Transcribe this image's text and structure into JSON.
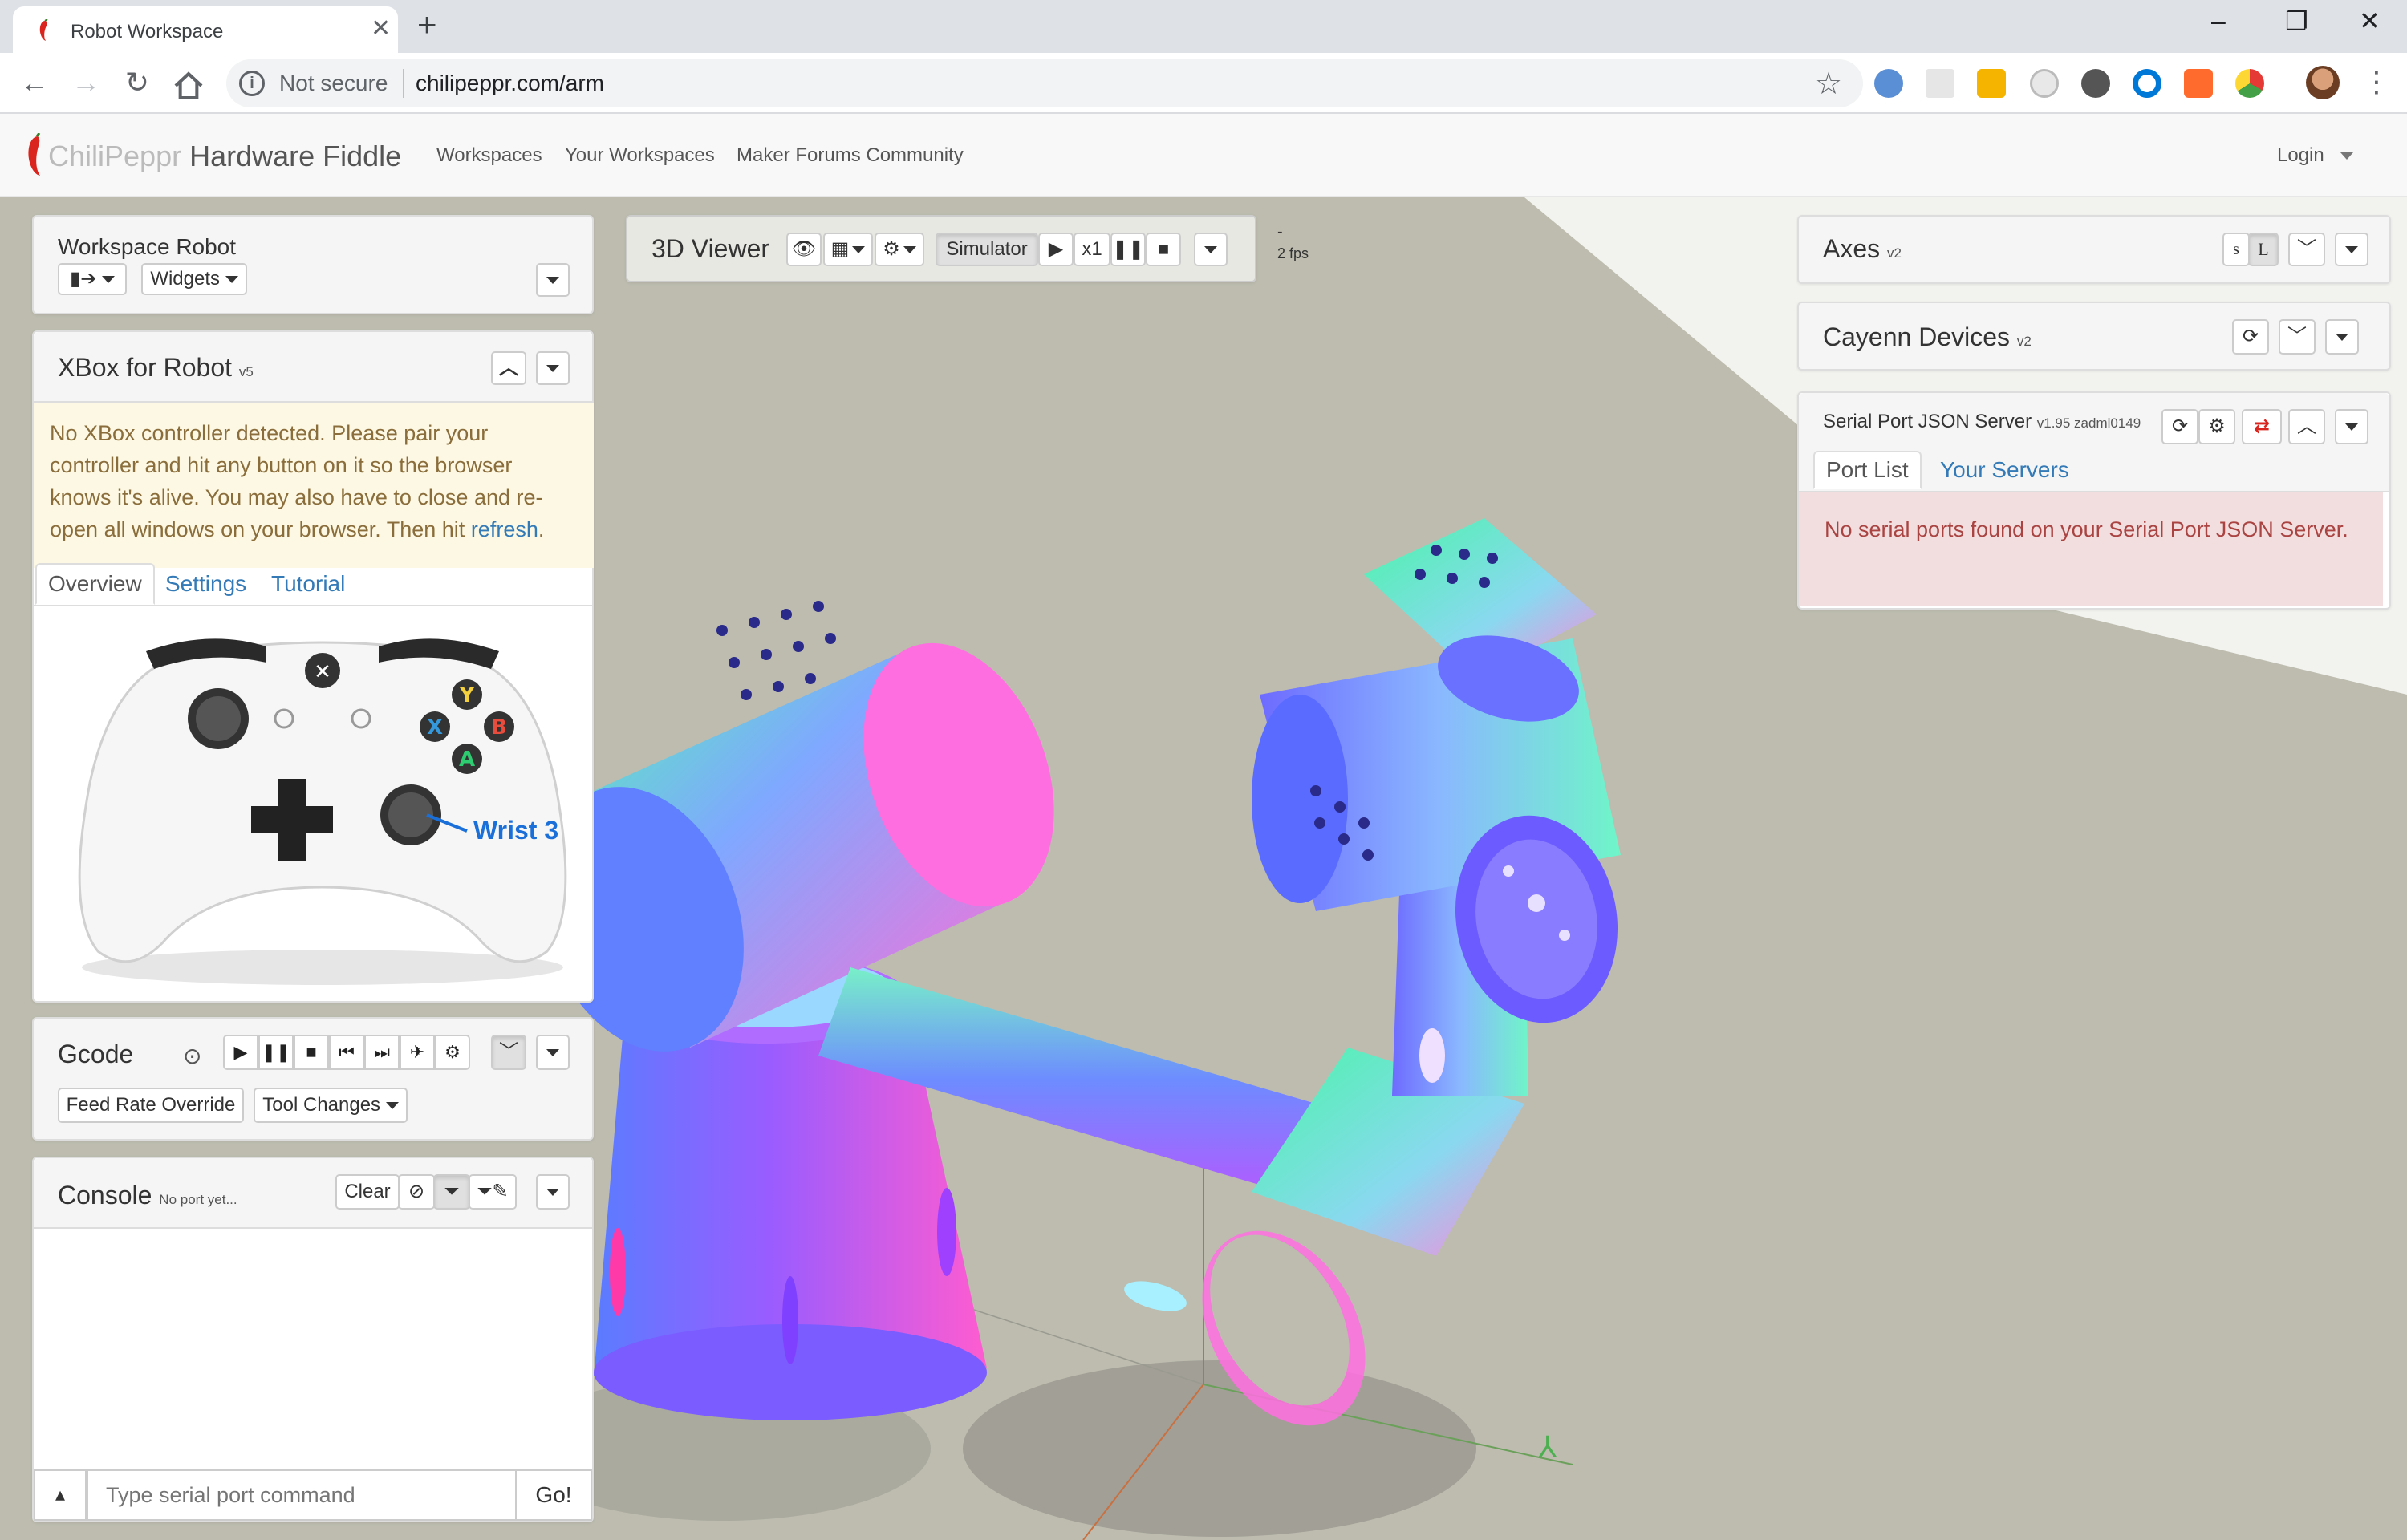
{
  "browser": {
    "tab_title": "Robot Workspace",
    "tab_close": "✕",
    "new_tab": "+",
    "security_label": "Not secure",
    "url": "chilipeppr.com/arm",
    "window_controls": [
      "–",
      "❐",
      "✕"
    ]
  },
  "site": {
    "brand_part1": "ChiliPeppr",
    "brand_part2": " Hardware Fiddle",
    "nav": [
      "Workspaces",
      "Your Workspaces",
      "Maker Forums Community"
    ],
    "login": "Login"
  },
  "workspace_panel": {
    "title": "Workspace Robot",
    "widgets_label": "Widgets"
  },
  "xbox_panel": {
    "title": "XBox for Robot",
    "version": "v5",
    "alert_text": "No XBox controller detected. Please pair your controller and hit any button on it so the browser knows it's alive. You may also have to close and re-open all windows on your browser. Then hit ",
    "alert_link": "refresh",
    "alert_end": ".",
    "tabs": [
      "Overview",
      "Settings",
      "Tutorial"
    ],
    "controller_label": "Wrist 3",
    "buttons": {
      "y": "Y",
      "x": "X",
      "a": "A",
      "b": "B"
    }
  },
  "gcode_panel": {
    "title": "Gcode",
    "feed_rate_label": "Feed Rate Override",
    "tool_changes_label": "Tool Changes"
  },
  "console_panel": {
    "title": "Console",
    "subtitle": "No port yet...",
    "clear_label": "Clear",
    "input_placeholder": "Type serial port command",
    "go_label": "Go!"
  },
  "viewer_bar": {
    "title": "3D Viewer",
    "simulator_label": "Simulator",
    "speed_label": "x1",
    "fps_dash": "-",
    "fps_label": "2 fps"
  },
  "axes_panel": {
    "title": "Axes",
    "version": "v2",
    "s_label": "s",
    "l_label": "L"
  },
  "cayenn_panel": {
    "title": "Cayenn Devices",
    "version": "v2"
  },
  "serial_panel": {
    "title": "Serial Port JSON Server",
    "version": "v1.95 zadml0149",
    "tabs": [
      "Port List",
      "Your Servers"
    ],
    "alert_text": "No serial ports found on your Serial Port JSON Server."
  }
}
